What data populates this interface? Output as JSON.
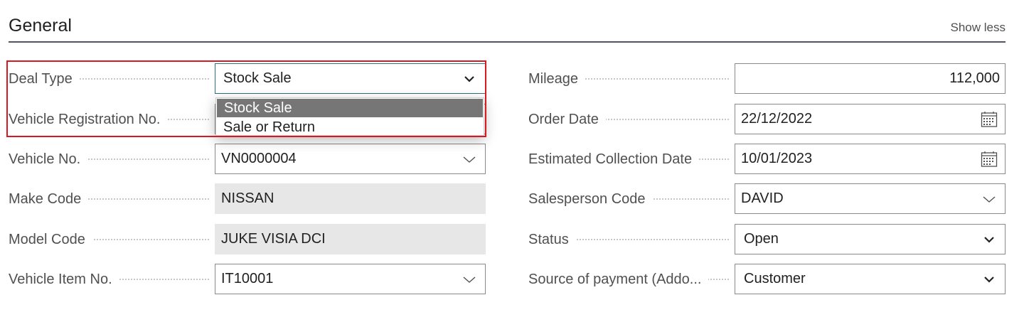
{
  "section": {
    "title": "General",
    "show_less": "Show less"
  },
  "left_fields": [
    {
      "label": "Deal Type",
      "value": "Stock Sale",
      "control": "select"
    },
    {
      "label": "Vehicle Registration No.",
      "value": "",
      "control": "hidden"
    },
    {
      "label": "Vehicle No.",
      "value": "VN0000004",
      "control": "lookup"
    },
    {
      "label": "Make Code",
      "value": "NISSAN",
      "control": "readonly"
    },
    {
      "label": "Model Code",
      "value": "JUKE VISIA DCI",
      "control": "readonly"
    },
    {
      "label": "Vehicle Item No.",
      "value": "IT10001",
      "control": "lookup"
    }
  ],
  "right_fields": [
    {
      "label": "Mileage",
      "value": "112,000",
      "control": "number"
    },
    {
      "label": "Order Date",
      "value": "22/12/2022",
      "control": "date"
    },
    {
      "label": "Estimated Collection Date",
      "value": "10/01/2023",
      "control": "date"
    },
    {
      "label": "Salesperson Code",
      "value": "DAVID",
      "control": "lookup"
    },
    {
      "label": "Status",
      "value": "Open",
      "control": "select"
    },
    {
      "label": "Source of payment (Addo...",
      "value": "Customer",
      "control": "select"
    }
  ],
  "deal_type_dropdown": {
    "options": [
      "Stock Sale",
      "Sale or Return"
    ],
    "selected": "Stock Sale"
  },
  "colors": {
    "highlight": "#d71921",
    "selected_option": "#767676",
    "readonly_bg": "#e7e7e7"
  }
}
